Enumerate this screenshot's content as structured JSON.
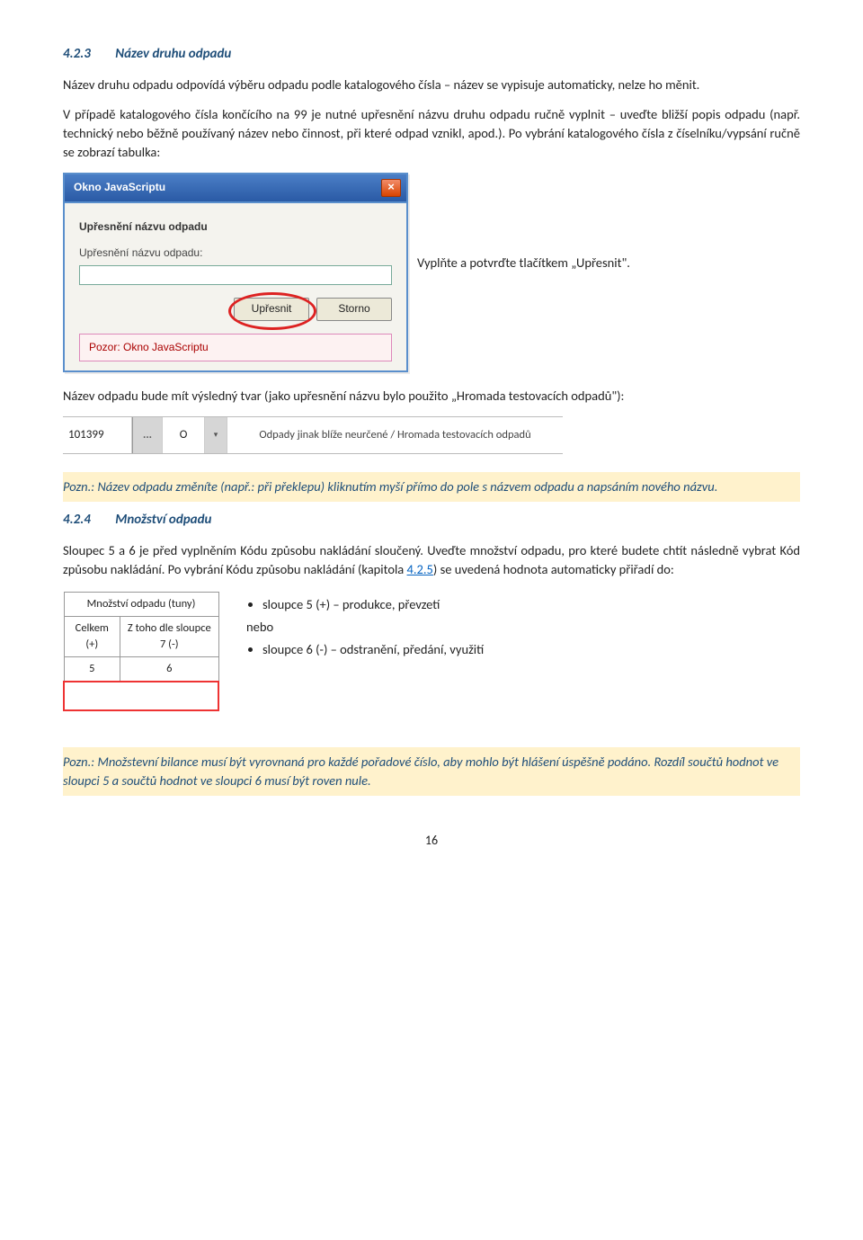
{
  "sec1": {
    "number": "4.2.3",
    "title": "Název druhu odpadu",
    "p1": "Název druhu odpadu odpovídá výběru odpadu podle katalogového čísla – název se vypisuje automaticky, nelze ho měnit.",
    "p2": "V případě katalogového čísla končícího na 99 je nutné upřesnění názvu druhu odpadu ručně vyplnit – uveďte bližší popis odpadu (např. technický nebo běžně používaný název nebo činnost, při které odpad vznikl, apod.). Po vybrání katalogového čísla z číselníku/vypsání ručně se zobrazí tabulka:"
  },
  "dialog": {
    "title": "Okno JavaScriptu",
    "close": "×",
    "heading": "Upřesnění názvu odpadu",
    "label": "Upřesnění názvu odpadu:",
    "input_value": "",
    "btn_ok": "Upřesnit",
    "btn_cancel": "Storno",
    "warning": "Pozor: Okno JavaScriptu"
  },
  "sidetext": "Vyplňte a potvrďte tlačítkem „Upřesnit\".",
  "p3": "Název odpadu bude mít výsledný tvar (jako upřesnění názvu bylo použito „Hromada testovacích odpadů\"):",
  "row": {
    "code": "101399",
    "dots": "...",
    "cat": "O",
    "arrow": "▾",
    "desc": "Odpady jinak blíže neurčené / Hromada testovacích odpadů"
  },
  "note1": "Pozn.: Název odpadu změníte (např.: při překlepu) kliknutím myší přímo do pole s názvem odpadu a napsáním nového názvu.",
  "sec2": {
    "number": "4.2.4",
    "title": "Množství odpadu",
    "p1a": "Sloupec 5 a 6 je před vyplněním Kódu způsobu nakládání sloučený. Uveďte množství odpadu, pro které budete chtít následně vybrat Kód způsobu nakládání. Po vybrání Kódu způsobu nakládání (kapitola ",
    "link": "4.2.5",
    "p1b": ") se uvedená hodnota automaticky přiřadí do:"
  },
  "qtable": {
    "h1": "Množství odpadu (tuny)",
    "c1": "Celkem (+)",
    "c2": "Z toho dle sloupce 7 (-)",
    "n1": "5",
    "n2": "6"
  },
  "bullets": {
    "b1": "sloupce 5 (+) – produkce, převzetí",
    "nebo": "nebo",
    "b2": "sloupce 6 (-) – odstranění, předání, využití"
  },
  "note2": "Pozn.: Množstevní bilance musí být vyrovnaná pro každé pořadové číslo, aby mohlo být hlášení úspěšně podáno. Rozdíl součtů hodnot ve sloupci 5 a součtů hodnot ve sloupci 6 musí být roven nule.",
  "pagenum": "16"
}
